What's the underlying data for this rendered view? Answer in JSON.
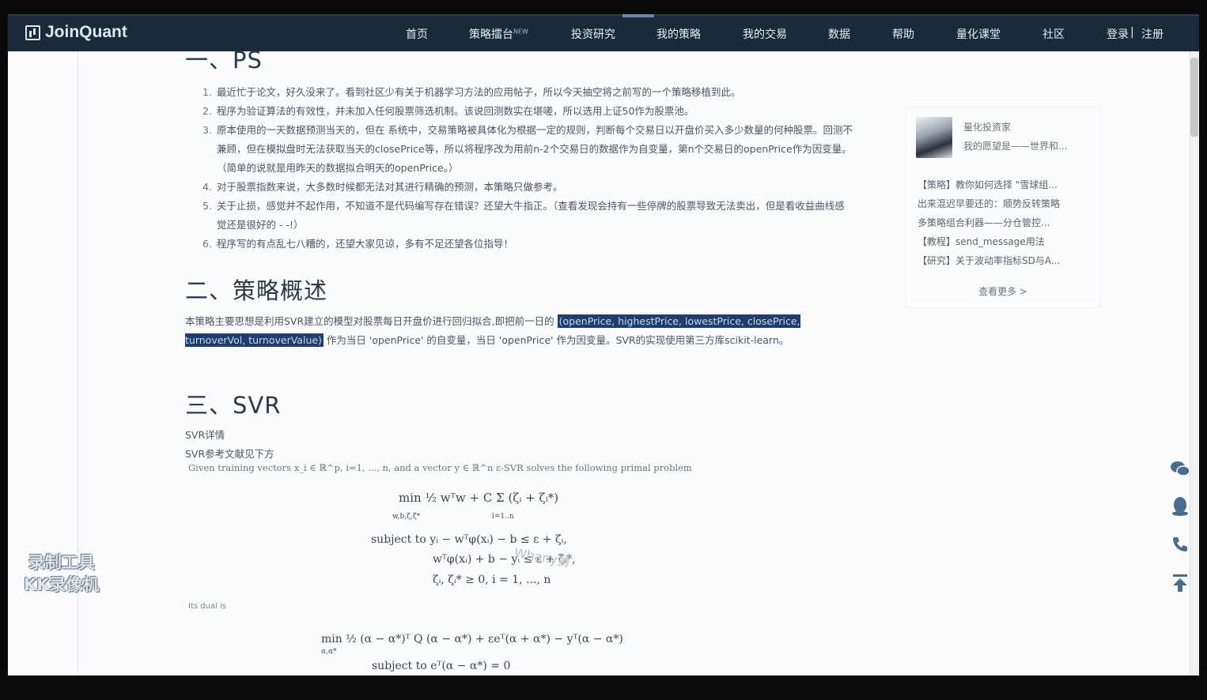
{
  "app": {
    "brand": "JoinQuant"
  },
  "nav": {
    "items": [
      {
        "label": "首页"
      },
      {
        "label": "策略擂台",
        "badge": "NEW"
      },
      {
        "label": "投资研究"
      },
      {
        "label": "我的策略"
      },
      {
        "label": "我的交易"
      },
      {
        "label": "数据"
      },
      {
        "label": "帮助"
      },
      {
        "label": "量化课堂"
      },
      {
        "label": "社区"
      }
    ],
    "login": "登录",
    "separator": "|",
    "register": "注册"
  },
  "article": {
    "sec1_title": "一、PS",
    "notes": [
      {
        "num": "1.",
        "text": "最近忙于论文，好久没来了。看到社区少有关于机器学习方法的应用帖子，所以今天抽空将之前写的一个策略移植到此。"
      },
      {
        "num": "2.",
        "text": "程序为验证算法的有效性，并未加入任何股票筛选机制。该说回测数实在堪嗟，所以选用上证50作为股票池。"
      },
      {
        "num": "3.",
        "text": "原本使用的一天数据预测当天的，但在 系统中，交易策略被具体化为根据一定的规则，判断每个交易日以开盘价买入多少数量的何种股票。回测不兼顾，但在模拟盘时无法获取当天的closePrice等，所以将程序改为用前n-2个交易日的数据作为自变量，第n个交易日的openPrice作为因变量。（简单的说就是用昨天的数据拟合明天的openPrice。）"
      },
      {
        "num": "4.",
        "text": "对于股票指数来说，大多数时候都无法对其进行精确的预测，本策略只做参考。"
      },
      {
        "num": "5.",
        "text": "关于止损，感觉并不起作用，不知道不是代码编写存在错误？还望大牛指正。（查看发现会持有一些停牌的股票导致无法卖出，但是看收益曲线感觉还是很好的 - -!）"
      },
      {
        "num": "6.",
        "text": "程序写的有点乱七八糟的，还望大家见谅，多有不足还望各位指导！"
      }
    ],
    "sec2_title": "二、策略概述",
    "overview_pre": "本策略主要思想是利用SVR建立的模型对股票每日开盘价进行回归拟合,即把前一日的",
    "overview_hl": "(openPrice, highestPrice, lowestPrice, closePrice, turnoverVol, turnoverValue)",
    "overview_post": "作为当日 'openPrice' 的自变量，当日 'openPrice' 作为因变量。SVR的实现使用第三方库scikit-learn。",
    "sec3_title": "三、SVR",
    "svr_links": [
      "SVR详情",
      "SVR参考文献见下方"
    ],
    "given": "Given training vectors x_i ∈ ℝ^p, i=1, ..., n, and a vector y ∈ ℝ^n ε-SVR solves the following primal problem",
    "math": {
      "primal": "min  ½ wᵀw + C Σ (ζᵢ + ζᵢ*)",
      "primal_sub": "w,b,ζ,ζ*",
      "primal_idx": "i=1..n",
      "st1": "subject to  yᵢ − wᵀφ(xᵢ) − b ≤ ε + ζᵢ,",
      "st2": "wᵀφ(xᵢ) + b − yᵢ ≤ ε + ζᵢ*,",
      "st3": "ζᵢ, ζᵢ* ≥ 0, i = 1, ..., n",
      "dual_label": "Its dual is",
      "dual": "min  ½ (α − α*)ᵀ Q (α − α*) + εeᵀ(α + α*) − yᵀ(α − α*)",
      "dual_sub": "α,α*",
      "dual_st": "subject to  eᵀ(α − α*) = 0"
    }
  },
  "sidebar": {
    "author_name": "量化投资家",
    "author_bio": "我的愿望是——世界和...",
    "links": [
      "【策略】教你如何选择 \"雪球组...",
      "出来混迟早要还的：顺势反转策略",
      "多策略组合利器——分仓管控...",
      "【教程】send_message用法",
      "【研究】关于波动率指标SD与A..."
    ],
    "more": "查看更多 >"
  },
  "overlay": {
    "recorder_line1": "录制工具",
    "recorder_line2": "KK录像机",
    "author_mark": "Whany舅"
  }
}
